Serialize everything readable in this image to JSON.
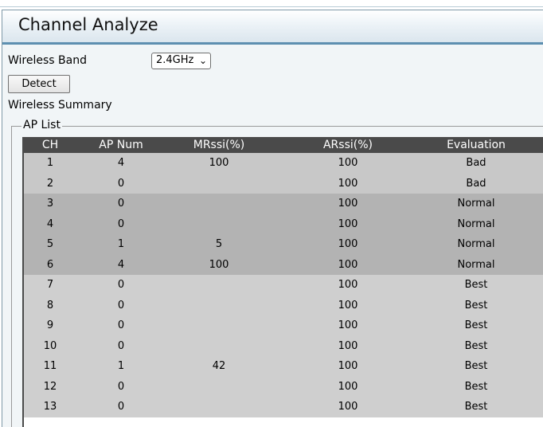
{
  "panel": {
    "title": "Channel Analyze"
  },
  "form": {
    "band_label": "Wireless Band",
    "band_value": "2.4GHz",
    "detect_label": "Detect",
    "summary_label": "Wireless Summary",
    "ap_list_label": "AP List"
  },
  "table": {
    "headers": {
      "ch": "CH",
      "ap_num": "AP Num",
      "mrssi": "MRssi(%)",
      "arssi": "ARssi(%)",
      "evaluation": "Evaluation"
    },
    "rows": [
      {
        "ch": "1",
        "ap_num": "4",
        "mrssi": "100",
        "arssi": "100",
        "evaluation": "Bad"
      },
      {
        "ch": "2",
        "ap_num": "0",
        "mrssi": "",
        "arssi": "100",
        "evaluation": "Bad"
      },
      {
        "ch": "3",
        "ap_num": "0",
        "mrssi": "",
        "arssi": "100",
        "evaluation": "Normal"
      },
      {
        "ch": "4",
        "ap_num": "0",
        "mrssi": "",
        "arssi": "100",
        "evaluation": "Normal"
      },
      {
        "ch": "5",
        "ap_num": "1",
        "mrssi": "5",
        "arssi": "100",
        "evaluation": "Normal"
      },
      {
        "ch": "6",
        "ap_num": "4",
        "mrssi": "100",
        "arssi": "100",
        "evaluation": "Normal"
      },
      {
        "ch": "7",
        "ap_num": "0",
        "mrssi": "",
        "arssi": "100",
        "evaluation": "Best"
      },
      {
        "ch": "8",
        "ap_num": "0",
        "mrssi": "",
        "arssi": "100",
        "evaluation": "Best"
      },
      {
        "ch": "9",
        "ap_num": "0",
        "mrssi": "",
        "arssi": "100",
        "evaluation": "Best"
      },
      {
        "ch": "10",
        "ap_num": "0",
        "mrssi": "",
        "arssi": "100",
        "evaluation": "Best"
      },
      {
        "ch": "11",
        "ap_num": "1",
        "mrssi": "42",
        "arssi": "100",
        "evaluation": "Best"
      },
      {
        "ch": "12",
        "ap_num": "0",
        "mrssi": "",
        "arssi": "100",
        "evaluation": "Best"
      },
      {
        "ch": "13",
        "ap_num": "0",
        "mrssi": "",
        "arssi": "100",
        "evaluation": "Best"
      }
    ]
  },
  "icons": {
    "select_arrow": "chevron-down-icon"
  },
  "colors": {
    "header_bar": "#4a4a4a",
    "accent_border": "#5d8fb0"
  }
}
